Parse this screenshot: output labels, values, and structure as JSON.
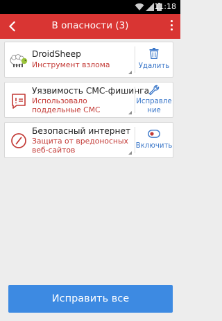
{
  "status_bar": {
    "time": "11:18",
    "icons": [
      "wifi-icon",
      "signal-icon",
      "battery-icon"
    ]
  },
  "app_bar": {
    "title": "В опасности (3)",
    "back_icon": "back-arrow-icon",
    "menu_icon": "more-vert-icon"
  },
  "colors": {
    "app_bar": "#d93533",
    "danger_text": "#c33a36",
    "action_text": "#3c78c9",
    "primary_button": "#3d8ae2"
  },
  "threats": [
    {
      "icon": "droidsheep-sheep-icon",
      "title": "DroidSheep",
      "description": "Инструмент взлома",
      "action_icon": "trash-icon",
      "action_label": "Удалить"
    },
    {
      "icon": "sms-message-icon",
      "title": "Уязвимость СМС-фишинга",
      "description": "Использовало поддельные СМС",
      "action_icon": "wrench-icon",
      "action_label": "Исправле ние"
    },
    {
      "icon": "compass-icon",
      "title": "Безопасный интернет",
      "description": "Защита от вредоносных веб-сайтов",
      "action_icon": "toggle-icon",
      "action_label": "Включить"
    }
  ],
  "fix_all_button": {
    "label": "Исправить все"
  }
}
